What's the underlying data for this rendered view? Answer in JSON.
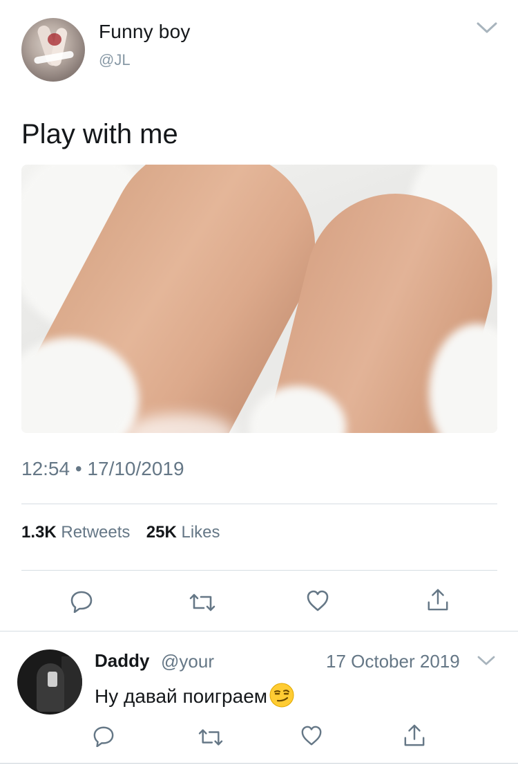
{
  "tweet": {
    "author_name": "Funny boy",
    "author_handle": "@JL",
    "text": "Play with me",
    "timestamp": "12:54 • 17/10/2019",
    "retweets_count": "1.3K",
    "retweets_label": "Retweets",
    "likes_count": "25K",
    "likes_label": "Likes"
  },
  "reply": {
    "author_name": "Daddy",
    "author_handle": "@your",
    "date": "17 October 2019",
    "text": "Ну давай поиграем",
    "emoji": "smirking-face"
  },
  "icons": {
    "more": "chevron-down-icon",
    "reply": "reply-icon",
    "retweet": "retweet-icon",
    "like": "heart-icon",
    "share": "share-icon"
  },
  "colors": {
    "text_primary": "#14171a",
    "text_secondary": "#657786",
    "divider": "#d6dde3"
  }
}
